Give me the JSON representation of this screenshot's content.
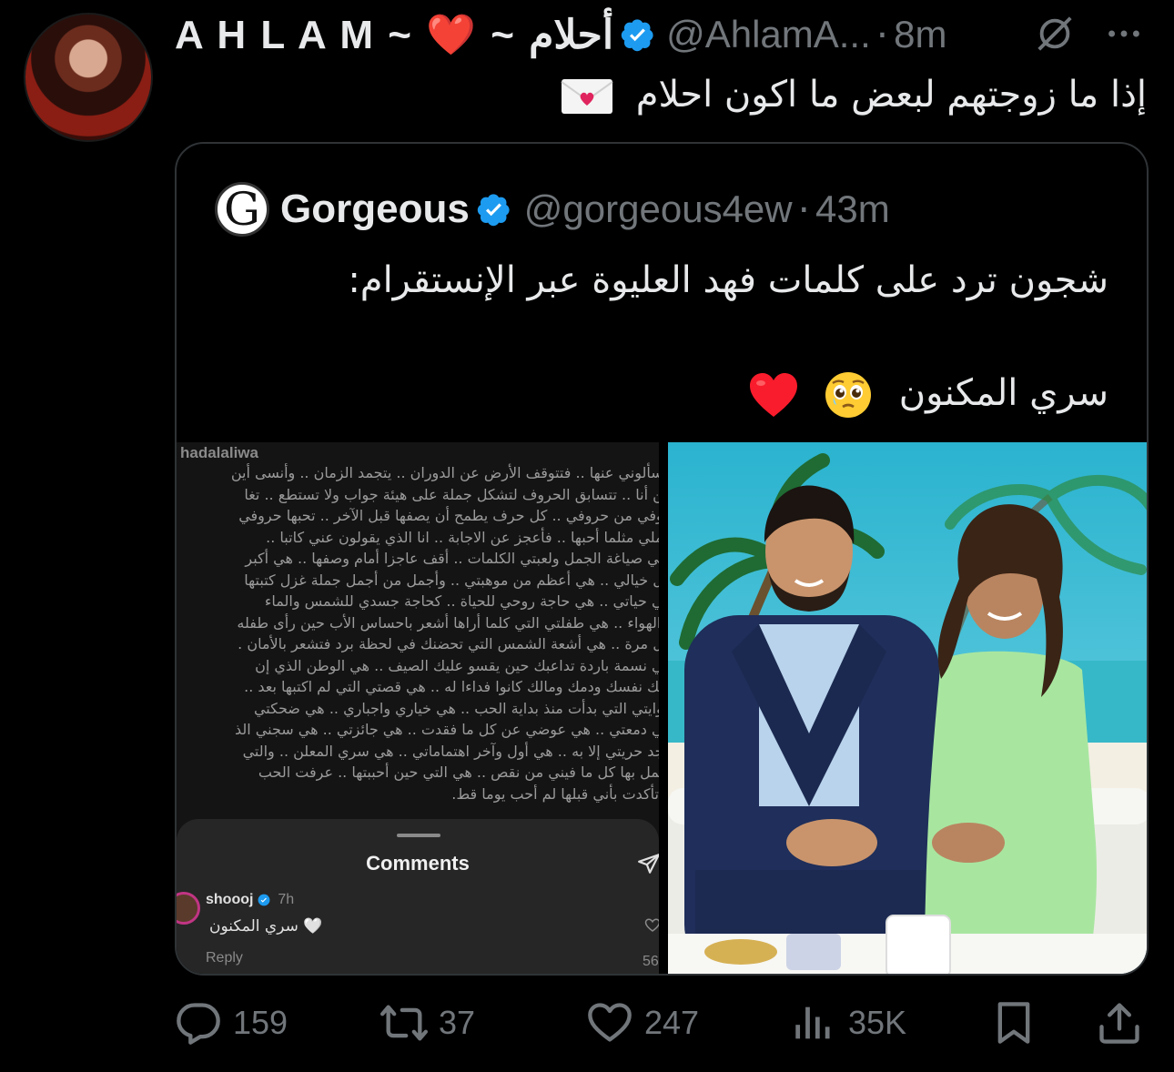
{
  "post": {
    "author_name": "A H L A M ~ ❤️ ~ أحلام",
    "handle": "@AhlamA...",
    "time": "8m",
    "text": "إذا ما زوجتهم لبعض ما اكون احلام"
  },
  "quote": {
    "avatar_letter": "G",
    "author_name": "Gorgeous",
    "handle": "@gorgeous4ew",
    "time": "43m",
    "text_line1": "شجون ترد على كلمات فهد العليوة عبر الإنستقرام:",
    "text_line2": "سري المكنون"
  },
  "instagram_screenshot": {
    "username": "hadalaliwa",
    "lines": [
      "يسألوني عنها .. فتتوقف الأرض عن الدوران .. يتجمد الزمان .. وأنسى أين",
      "ـن أنا .. تتسابق الحروف لتشكل جملة على هيئة جواب ولا تستطع .. تغا",
      "ـوفي من حروفي .. كل حرف يطمح أن يصفها قبل الآخر .. تحبها حروفي",
      "ـملي مثلما أحبها .. فأعجز عن الاجابة .. انا الذي يقولون عني كاتبا ..",
      "ـتي صياغة الجمل ولعبتي الكلمات .. أقف عاجزا أمام وصفها .. هي أكبر",
      "ـل خيالي .. هي أعظم من موهبتي .. وأجمل من أجمل جملة غزل كتبتها",
      "ـي حياتي .. هي حاجة روحي للحياة .. كحاجة جسدي للشمس والماء",
      "والهواء .. هي طفلتي التي كلما أراها أشعر باحساس الأب حين رأى طفله",
      "ـل مرة .. هي أشعة الشمس التي تحضنك في لحظة برد فتشعر بالأمان .",
      "ـي نسمة باردة تداعبك حين يقسو عليك الصيف .. هي الوطن الذي إن",
      "ـبك نفسك ودمك ومالك كانوا فداءا له .. هي قصتي التي لم اكتبها بعد ..",
      "ـوايتي التي بدأت منذ بداية الحب .. هي خياري واجباري .. هي ضحكتي",
      "ـي دمعتي .. هي عوضي عن كل ما فقدت .. هي جائزتي .. هي سجني الذ",
      "أجد حريتي إلا به .. هي أول وآخر اهتماماتي .. هي سري المعلن .. والتي",
      "ـتمل بها كل ما فيني من نقص .. هي التي حين أحببتها .. عرفت الحب",
      "تأكدت بأني قبلها لم أحب يوما قط."
    ],
    "comments_title": "Comments",
    "comment_user": "shoooj",
    "comment_time": "7h",
    "comment_text": "سري المكنون 🤍",
    "reply_label": "Reply",
    "likes_partial": "56"
  },
  "actions": {
    "replies": "159",
    "reposts": "37",
    "likes": "247",
    "views": "35K"
  },
  "colors": {
    "background": "#000000",
    "text": "#e7e9ea",
    "muted": "#71767b",
    "verified": "#1d9bf0",
    "heart": "#f91c2c"
  }
}
